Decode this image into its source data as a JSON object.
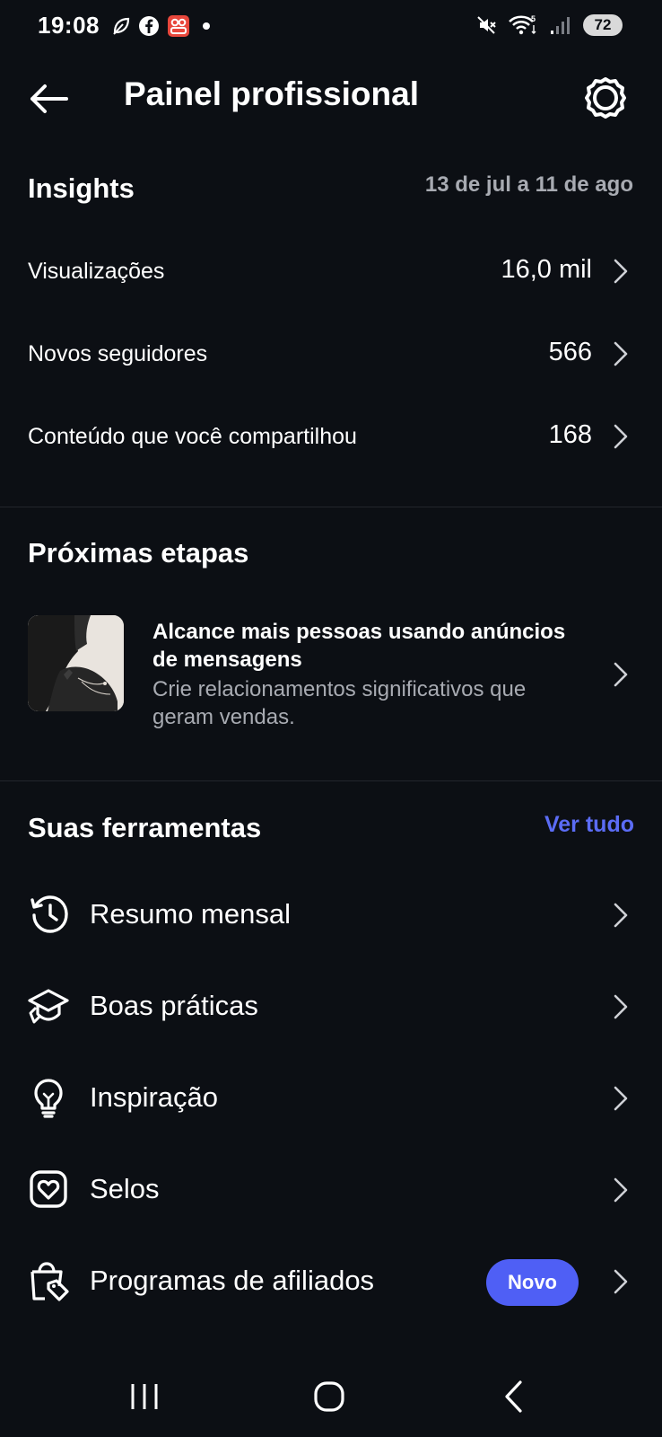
{
  "status_bar": {
    "time": "19:08",
    "battery": "72",
    "left_icons": [
      "leaf-icon",
      "facebook-icon",
      "app-icon",
      "notification-dot"
    ],
    "right_icons": [
      "mute-icon",
      "wifi-icon",
      "signal-icon",
      "battery-icon"
    ]
  },
  "header": {
    "title": "Painel profissional",
    "back_icon": "arrow-left-icon",
    "settings_icon": "gear-icon"
  },
  "insights": {
    "title": "Insights",
    "date_range": "13 de jul a 11 de ago",
    "metrics": [
      {
        "label": "Visualizações",
        "value": "16,0 mil"
      },
      {
        "label": "Novos seguidores",
        "value": "566"
      },
      {
        "label": "Conteúdo que você compartilhou",
        "value": "168"
      }
    ]
  },
  "next_steps": {
    "title": "Próximas etapas",
    "card": {
      "title": "Alcance mais pessoas usando anúncios de mensagens",
      "subtitle": "Crie relacionamentos significativos que geram vendas."
    }
  },
  "tools": {
    "title": "Suas ferramentas",
    "see_all": "Ver tudo",
    "items": [
      {
        "label": "Resumo mensal",
        "icon": "history-icon"
      },
      {
        "label": "Boas práticas",
        "icon": "graduation-cap-icon"
      },
      {
        "label": "Inspiração",
        "icon": "lightbulb-icon"
      },
      {
        "label": "Selos",
        "icon": "heart-badge-icon"
      },
      {
        "label": "Programas de afiliados",
        "icon": "tag-shopping-bag-icon",
        "badge": "Novo"
      }
    ]
  },
  "colors": {
    "background": "#0c0f14",
    "accent": "#5b6cf5",
    "badge": "#4f5ff5",
    "secondary_text": "#a8abb2"
  },
  "nav_bar": {
    "icons": [
      "recent-apps-icon",
      "home-icon",
      "back-icon"
    ]
  }
}
